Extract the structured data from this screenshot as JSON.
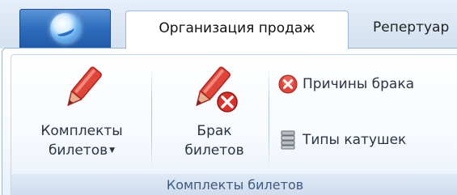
{
  "tabs": [
    {
      "label": "Организация продаж",
      "active": true
    },
    {
      "label": "Репертуар",
      "active": false
    }
  ],
  "ribbon": {
    "group_label": "Комплекты билетов",
    "buttons": {
      "ticket_sets": {
        "line1": "Комплекты",
        "line2": "билетов",
        "has_dropdown": true,
        "icon": "red-pen-icon"
      },
      "defect_tickets": {
        "line1": "Брак",
        "line2": "билетов",
        "icon": "red-pen-delete-icon"
      },
      "defect_reasons": {
        "label": "Причины брака",
        "icon": "red-x-circle-icon"
      },
      "reel_types": {
        "label": "Типы катушек",
        "icon": "reel-stack-icon"
      }
    }
  },
  "colors": {
    "accent": "#2f6ebd",
    "pen_red": "#e0453a",
    "delete_red": "#d8322a",
    "group_label_bg": "#d6e2f2"
  }
}
